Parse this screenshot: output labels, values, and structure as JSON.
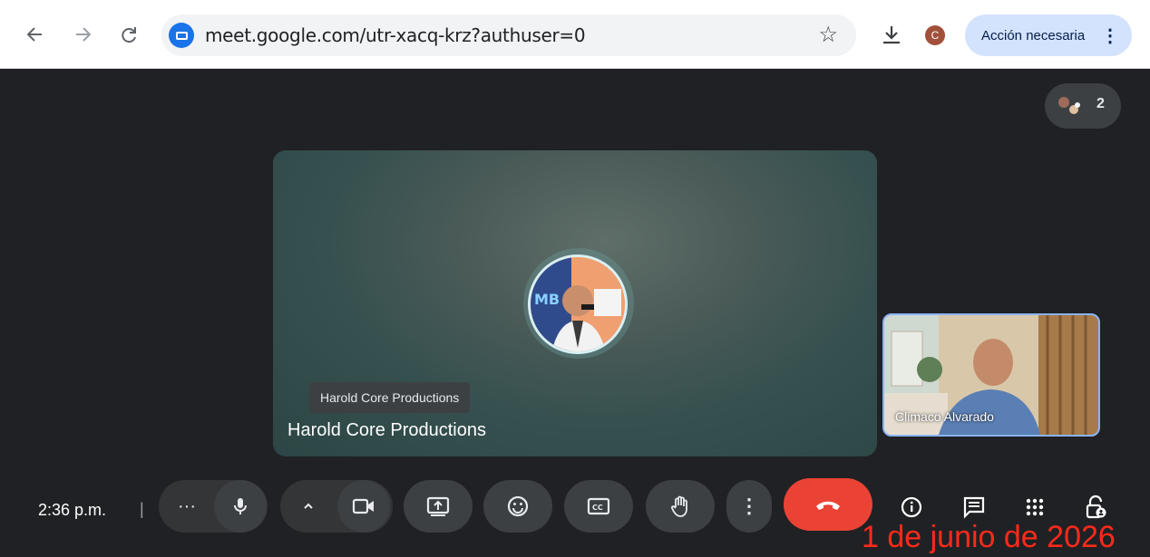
{
  "browser": {
    "url": "meet.google.com/utr-xacq-krz?authuser=0",
    "profile_initial": "C",
    "action_button_label": "Acción necesaria"
  },
  "meeting": {
    "participant_count": "2",
    "main_tile": {
      "tooltip": "Harold Core Productions",
      "name": "Harold Core Productions"
    },
    "self_tile": {
      "name": "Climaco Alvarado"
    }
  },
  "controls": {
    "time": "2:36 p.m.",
    "separator": "|"
  },
  "overlay": {
    "date_stamp": "1 de junio de 2026"
  },
  "colors": {
    "hangup": "#ea4335",
    "accent_blue": "#1a73e8",
    "action_pill": "#d3e3fd",
    "date_stamp": "#ff2a1a"
  }
}
